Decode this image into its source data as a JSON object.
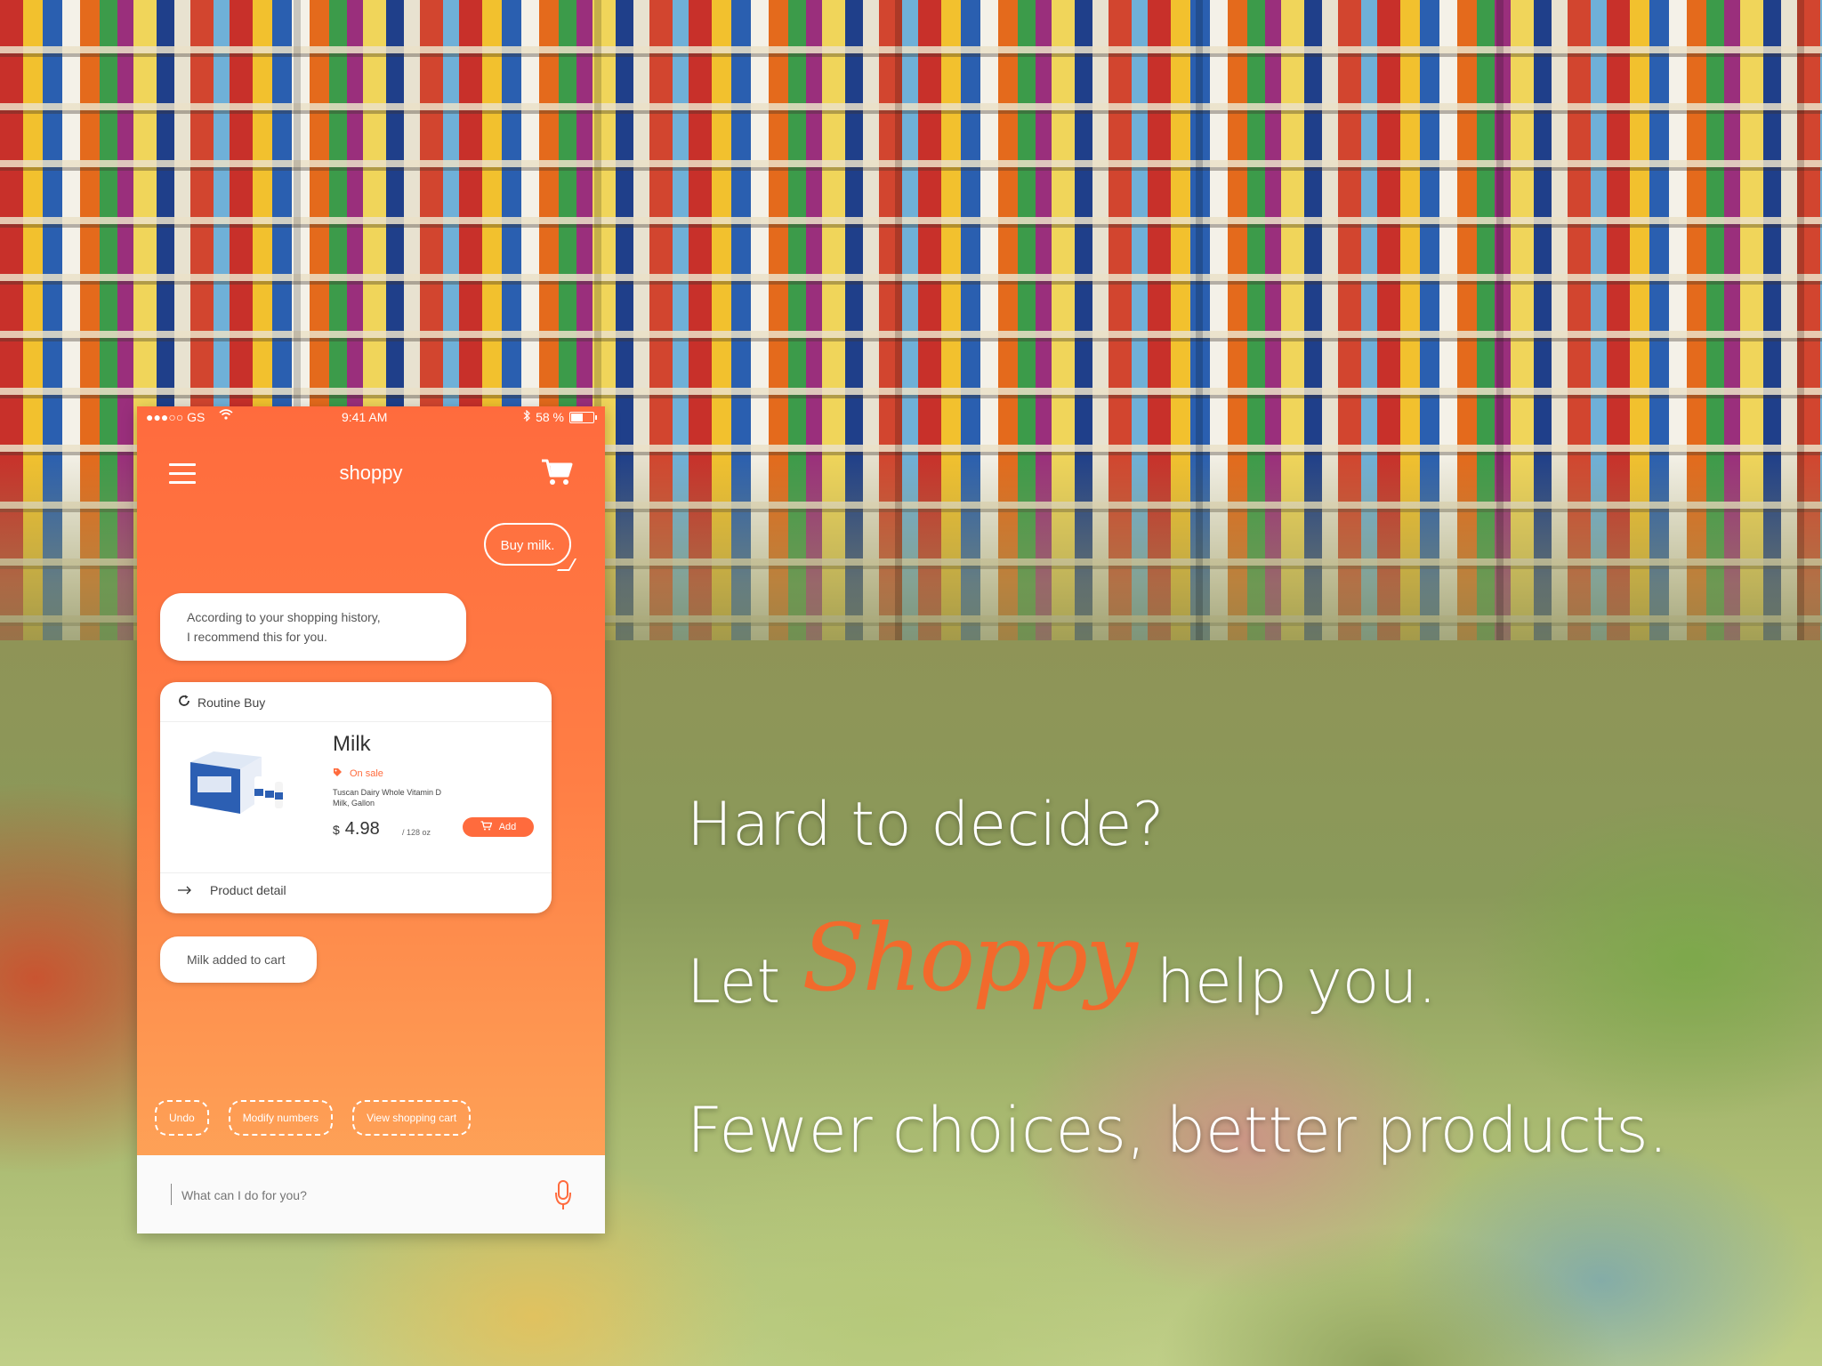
{
  "status_bar": {
    "carrier": "●●●○○ GS",
    "time": "9:41 AM",
    "battery": "58 %"
  },
  "nav": {
    "title": "shoppy"
  },
  "chat": {
    "user_message": "Buy milk.",
    "bot_message_1_line1": "According to your shopping history,",
    "bot_message_1_line2": "I recommend this for you.",
    "card": {
      "section_label": "Routine Buy",
      "product_name": "Milk",
      "badge": "On sale",
      "description_line1": "Tuscan Dairy Whole Vitamin D",
      "description_line2": "Milk, Gallon",
      "currency": "$",
      "price": "4.98",
      "unit": "/ 128 oz",
      "add_label": "Add",
      "detail_label": "Product detail"
    },
    "bot_message_2": "Milk added to cart"
  },
  "quick_actions": [
    "Undo",
    "Modify numbers",
    "View shopping cart"
  ],
  "input": {
    "placeholder": "What can I do for you?"
  },
  "headline": {
    "line1": "Hard to decide?",
    "line2_before": "Let",
    "brand": "Shoppy",
    "line2_after": "help you.",
    "line3": "Fewer choices, better products."
  },
  "colors": {
    "accent": "#ff6b3d",
    "gradient_bottom": "#fda85a"
  },
  "icons": [
    "menu-icon",
    "cart-icon",
    "refresh-icon",
    "tag-icon",
    "arrow-right-icon",
    "mic-icon",
    "wifi-icon",
    "bluetooth-icon",
    "battery-icon"
  ]
}
